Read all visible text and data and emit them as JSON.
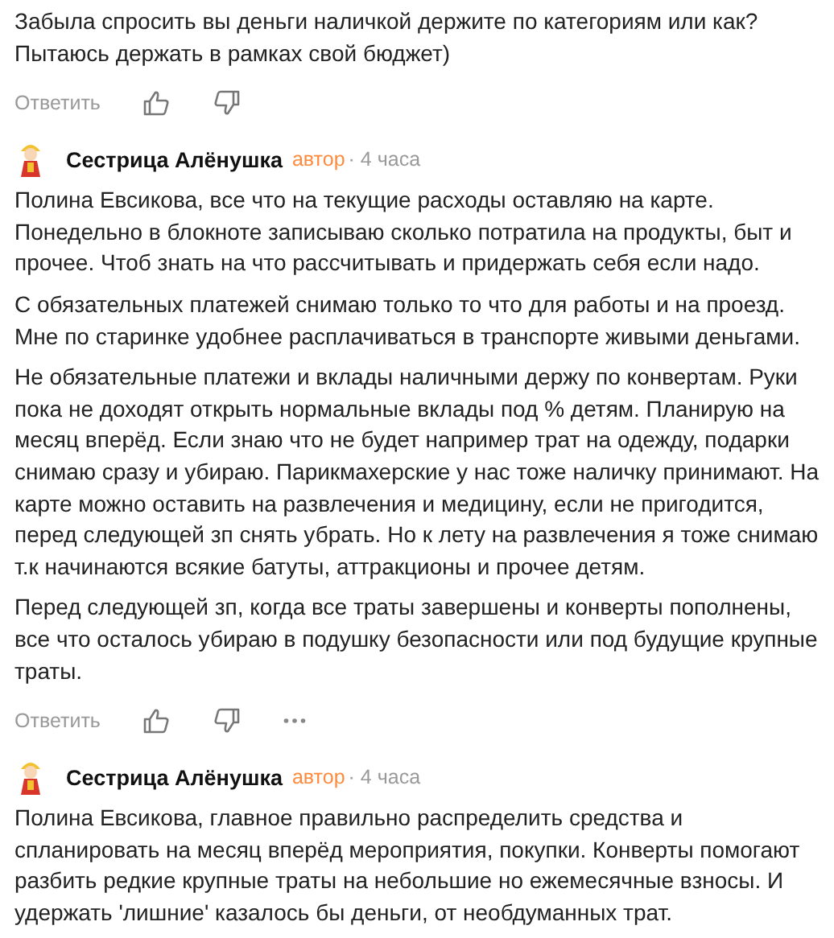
{
  "comments": [
    {
      "paragraphs": [
        "Забыла спросить вы деньги наличкой держите по категориям или как? Пытаюсь держать в рамках свой бюджет)"
      ],
      "actions": {
        "reply": "Ответить",
        "more": false
      }
    },
    {
      "author": {
        "name": "Сестрица Алёнушка",
        "badge": "автор",
        "time": "· 4 часа"
      },
      "paragraphs": [
        "Полина Евсикова, все что на текущие расходы оставляю на карте. Понедельно в блокноте записываю сколько потратила на продукты, быт и прочее. Чтоб знать на что рассчитывать и придержать себя если надо.",
        "С обязательных платежей снимаю только то что для работы и на проезд. Мне по старинке удобнее расплачиваться в транспорте живыми деньгами.",
        "Не обязательные платежи и вклады наличными держу по конвертам. Руки пока не доходят открыть нормальные вклады под % детям. Планирую на месяц вперёд. Если знаю что не будет например трат на одежду, подарки снимаю сразу и убираю. Парикмахерские у нас тоже наличку принимают. На карте можно оставить на развлечения и медицину, если не пригодится, перед следующей зп снять убрать. Но к лету на развлечения я тоже снимаю т.к начинаются всякие батуты, аттракционы и прочее детям.",
        "Перед следующей зп, когда все траты завершены и конверты пополнены, все что осталось убираю в подушку безопасности или под будущие крупные траты."
      ],
      "actions": {
        "reply": "Ответить",
        "more": true
      }
    },
    {
      "author": {
        "name": "Сестрица Алёнушка",
        "badge": "автор",
        "time": "· 4 часа"
      },
      "paragraphs": [
        "Полина Евсикова, главное правильно распределить средства и спланировать на месяц вперёд мероприятия, покупки. Конверты помогают разбить редкие крупные траты на небольшие но ежемесячные взносы. И удержать 'лишние' казалось бы деньги, от необдуманных трат."
      ]
    }
  ]
}
